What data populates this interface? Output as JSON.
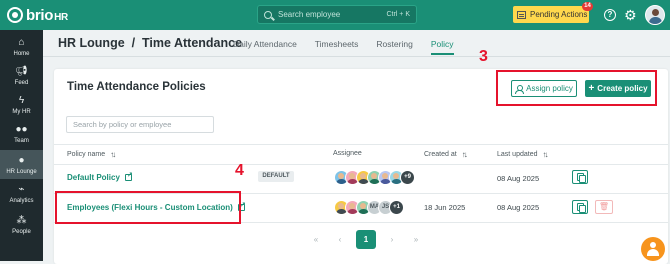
{
  "app": {
    "name": "brio",
    "name_suffix": "HR"
  },
  "search": {
    "placeholder": "Search employee",
    "shortcut": "Ctrl + K"
  },
  "pending": {
    "label": "Pending Actions",
    "count": "14"
  },
  "sidebar": {
    "items": [
      {
        "label": "Home",
        "icon": "home-icon"
      },
      {
        "label": "Feed",
        "icon": "megaphone-icon"
      },
      {
        "label": "My HR",
        "icon": "lightning-icon"
      },
      {
        "label": "Team",
        "icon": "team-icon"
      },
      {
        "label": "HR Lounge",
        "icon": "lounge-icon",
        "active": true
      },
      {
        "label": "Analytics",
        "icon": "chart-icon"
      },
      {
        "label": "People",
        "icon": "org-icon"
      }
    ]
  },
  "header": {
    "title": "HR Lounge  /  Time Attendance",
    "tabs": [
      {
        "label": "Daily Attendance"
      },
      {
        "label": "Timesheets"
      },
      {
        "label": "Rostering"
      },
      {
        "label": "Policy",
        "active": true
      }
    ]
  },
  "card": {
    "title": "Time Attendance Policies",
    "assign_label": "Assign policy",
    "create_label": "Create policy",
    "filter_placeholder": "Search by policy or employee"
  },
  "table": {
    "columns": {
      "name": "Policy name",
      "assignee": "Assignee",
      "created": "Created at",
      "updated": "Last updated"
    },
    "rows": [
      {
        "name": "Default Policy",
        "badge": "DEFAULT",
        "assignee_more": "+9",
        "created": "",
        "updated": "08 Aug 2025"
      },
      {
        "name": "Employees (Flexi Hours - Custom Location)",
        "assignee_initials": [
          "MA",
          "JS"
        ],
        "assignee_more": "+1",
        "created": "18 Jun 2025",
        "updated": "08 Aug 2025"
      }
    ]
  },
  "pagination": {
    "first": "«",
    "prev": "‹",
    "current": "1",
    "next": "›",
    "last": "»"
  },
  "annotations": {
    "num_3": "3",
    "num_4": "4"
  },
  "colors": {
    "brand": "#1a8f76",
    "highlight": "#e5132c",
    "pending": "#ffd84d"
  }
}
